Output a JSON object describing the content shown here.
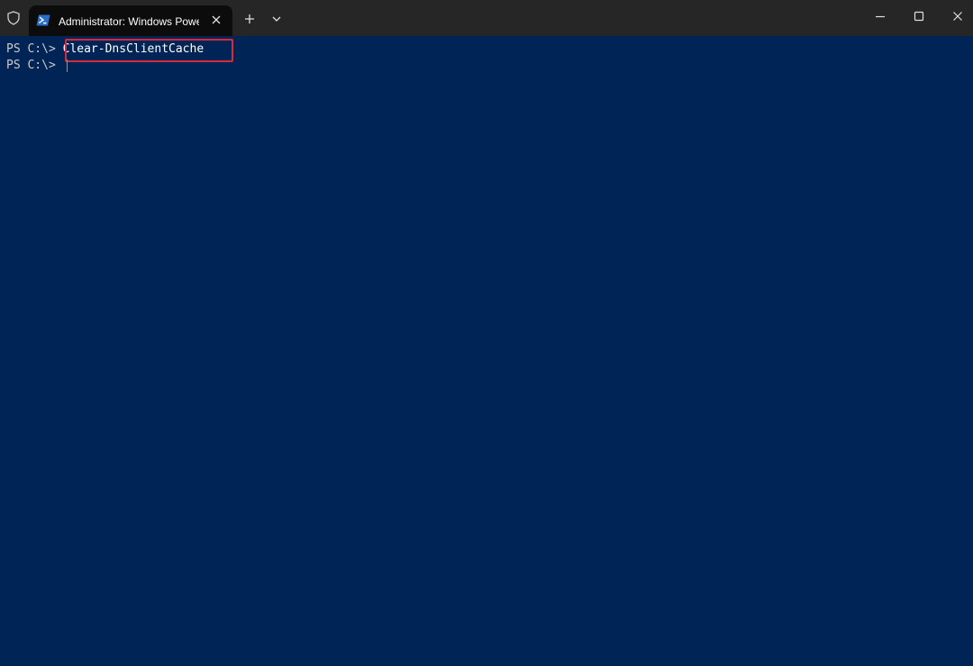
{
  "window": {
    "tab_title": "Administrator: Windows Powe",
    "icons": {
      "shield": "shield-icon",
      "tab": "powershell-icon",
      "tab_close": "close-icon",
      "new_tab": "plus-icon",
      "dropdown": "chevron-down-icon",
      "minimize": "minimize-icon",
      "maximize": "maximize-icon",
      "close": "close-icon"
    }
  },
  "terminal": {
    "lines": [
      {
        "prompt": "PS C:\\> ",
        "command": "Clear-DnsClientCache"
      },
      {
        "prompt": "PS C:\\> ",
        "command": ""
      }
    ]
  },
  "colors": {
    "background": "#012456",
    "titlebar": "#262626",
    "tab": "#0c0c0c",
    "highlight": "#d62b3a",
    "text": "#cccccc"
  }
}
